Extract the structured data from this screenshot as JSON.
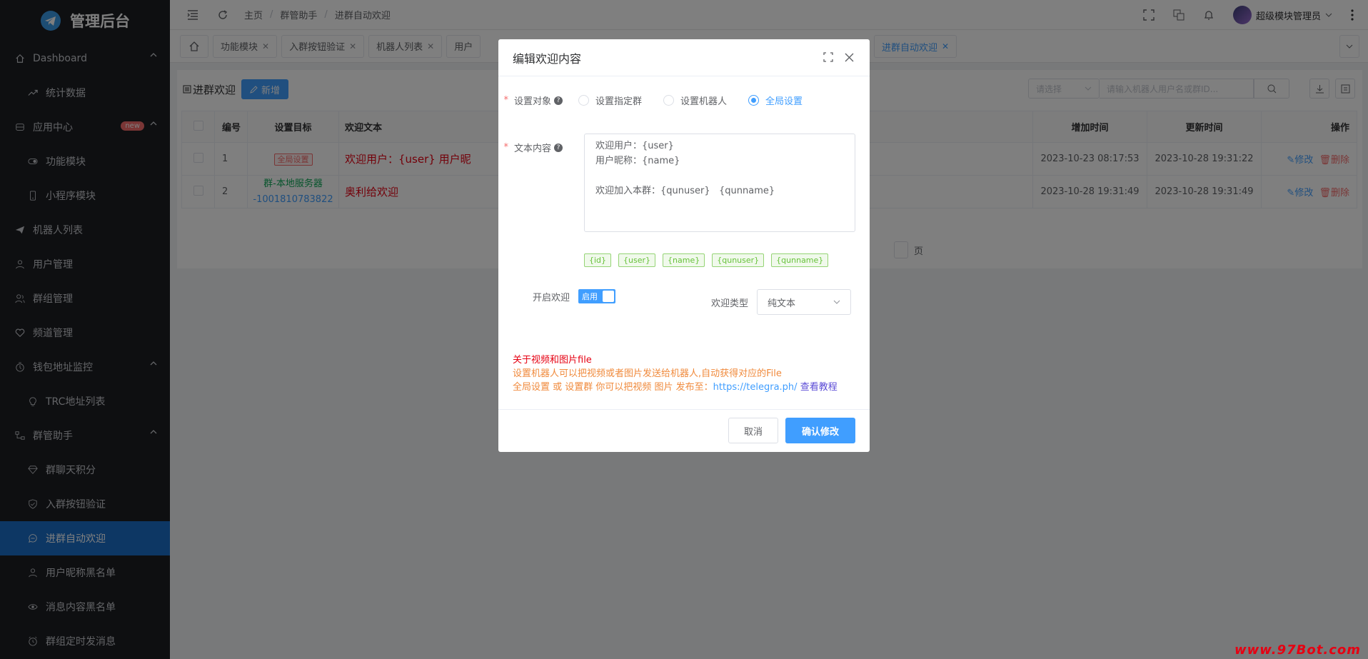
{
  "sidebar": {
    "title": "管理后台",
    "items": [
      {
        "label": "Dashboard",
        "icon": "home-icon",
        "level": 1,
        "expanded": true
      },
      {
        "label": "统计数据",
        "icon": "chart-line-icon",
        "level": 2
      },
      {
        "label": "应用中心",
        "icon": "app-icon",
        "level": 1,
        "badge": "new",
        "expanded": true
      },
      {
        "label": "功能模块",
        "icon": "toggle-icon",
        "level": 2
      },
      {
        "label": "小程序模块",
        "icon": "mobile-icon",
        "level": 2
      },
      {
        "label": "机器人列表",
        "icon": "send-icon",
        "level": 1
      },
      {
        "label": "用户管理",
        "icon": "user-icon",
        "level": 1
      },
      {
        "label": "群组管理",
        "icon": "users-icon",
        "level": 1
      },
      {
        "label": "频道管理",
        "icon": "heart-icon",
        "level": 1
      },
      {
        "label": "钱包地址监控",
        "icon": "timer-icon",
        "level": 1,
        "expanded": true
      },
      {
        "label": "TRC地址列表",
        "icon": "bulb-icon",
        "level": 2
      },
      {
        "label": "群管助手",
        "icon": "tree-icon",
        "level": 1,
        "expanded": true
      },
      {
        "label": "群聊天积分",
        "icon": "diamond-icon",
        "level": 2
      },
      {
        "label": "入群按钮验证",
        "icon": "shield-icon",
        "level": 2
      },
      {
        "label": "进群自动欢迎",
        "icon": "chat-icon",
        "level": 2,
        "active": true
      },
      {
        "label": "用户昵称黑名单",
        "icon": "user-icon",
        "level": 2
      },
      {
        "label": "消息内容黑名单",
        "icon": "eye-icon",
        "level": 2
      },
      {
        "label": "群组定时发消息",
        "icon": "clock-icon",
        "level": 2
      }
    ]
  },
  "breadcrumb": [
    "主页",
    "群管助手",
    "进群自动欢迎"
  ],
  "header": {
    "user": "超级模块管理员"
  },
  "tabs": [
    {
      "label": "功能模块"
    },
    {
      "label": "入群按钮验证"
    },
    {
      "label": "机器人列表"
    },
    {
      "label": "用户"
    },
    {
      "label": "进群自动欢迎",
      "active": true
    }
  ],
  "page": {
    "title": "进群欢迎",
    "add_label": "新增",
    "select_placeholder": "请选择",
    "search_placeholder": "请输入机器人用户名或群ID...",
    "columns": [
      "编号",
      "设置目标",
      "欢迎文本",
      "增加时间",
      "更新时间",
      "操作"
    ],
    "rows": [
      {
        "id": "1",
        "target_tag": "全局设置",
        "text": "欢迎用户：{user} 用户昵",
        "created": "2023-10-23 08:17:53",
        "updated": "2023-10-28 19:31:22"
      },
      {
        "id": "2",
        "target_name": "群-本地服务器",
        "target_id": "-1001810783822",
        "text": "奥利给欢迎",
        "created": "2023-10-28 19:31:49",
        "updated": "2023-10-28 19:31:49"
      }
    ],
    "edit_label": "修改",
    "delete_label": "删除",
    "pager_suffix": "页"
  },
  "modal": {
    "title": "编辑欢迎内容",
    "target_label": "设置对象",
    "target_options": [
      "设置指定群",
      "设置机器人",
      "全局设置"
    ],
    "target_selected": "全局设置",
    "text_label": "文本内容",
    "text_value": "欢迎用户：{user}\n用户昵称：{name}\n\n欢迎加入本群：{qunuser}   {qunname}",
    "variables": [
      "{id}",
      "{user}",
      "{name}",
      "{qunuser}",
      "{qunname}"
    ],
    "enable_label": "开启欢迎",
    "enable_switch_text": "启用",
    "type_label": "欢迎类型",
    "type_value": "纯文本",
    "note_title": "关于视频和图片file",
    "note_line1": "设置机器人可以把视频或者图片发送给机器人,自动获得对应的File",
    "note_line2_prefix": "全局设置 或 设置群 你可以把视频 图片 发布至：",
    "note_link": "https://telegra.ph/",
    "note_tutorial": "查看教程",
    "cancel_label": "取消",
    "confirm_label": "确认修改"
  },
  "watermark": "www.97Bot.com",
  "colors": {
    "primary": "#409eff",
    "sidebar_bg": "#1d1e23",
    "active_menu": "#1a6fc9",
    "danger": "#f56c6c",
    "success": "#67c23a"
  }
}
